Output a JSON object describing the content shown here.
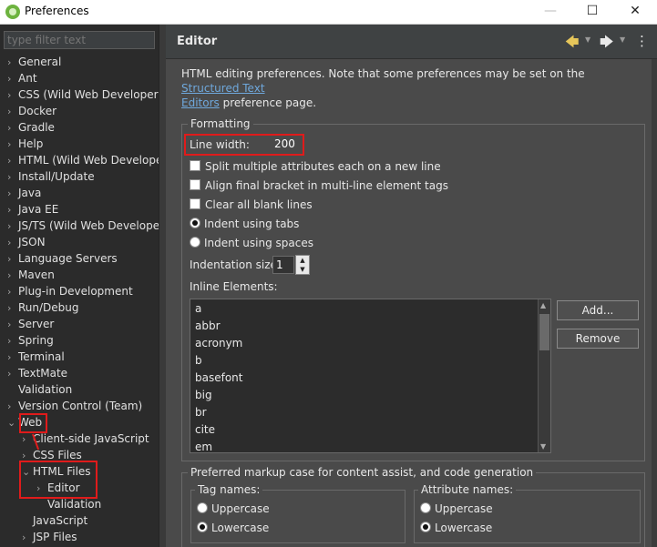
{
  "window": {
    "title": "Preferences",
    "min_label": "—",
    "max_label": "☐",
    "close_label": "✕"
  },
  "filter": {
    "placeholder": "type filter text"
  },
  "tree": [
    {
      "label": "General",
      "arrow": "›"
    },
    {
      "label": "Ant",
      "arrow": "›"
    },
    {
      "label": "CSS (Wild Web Developer)",
      "arrow": "›"
    },
    {
      "label": "Docker",
      "arrow": "›"
    },
    {
      "label": "Gradle",
      "arrow": "›"
    },
    {
      "label": "Help",
      "arrow": "›"
    },
    {
      "label": "HTML (Wild Web Develope",
      "arrow": "›"
    },
    {
      "label": "Install/Update",
      "arrow": "›"
    },
    {
      "label": "Java",
      "arrow": "›"
    },
    {
      "label": "Java EE",
      "arrow": "›"
    },
    {
      "label": "JS/TS (Wild Web Developer",
      "arrow": "›"
    },
    {
      "label": "JSON",
      "arrow": "›"
    },
    {
      "label": "Language Servers",
      "arrow": "›"
    },
    {
      "label": "Maven",
      "arrow": "›"
    },
    {
      "label": "Plug-in Development",
      "arrow": "›"
    },
    {
      "label": "Run/Debug",
      "arrow": "›"
    },
    {
      "label": "Server",
      "arrow": "›"
    },
    {
      "label": "Spring",
      "arrow": "›"
    },
    {
      "label": "Terminal",
      "arrow": "›"
    },
    {
      "label": "TextMate",
      "arrow": "›"
    },
    {
      "label": "Validation",
      "arrow": ""
    },
    {
      "label": "Version Control (Team)",
      "arrow": "›"
    },
    {
      "label": "Web",
      "arrow": "⌄"
    },
    {
      "label": "Client-side JavaScript",
      "arrow": "›"
    },
    {
      "label": "CSS Files",
      "arrow": "›"
    },
    {
      "label": "HTML Files",
      "arrow": "⌄"
    },
    {
      "label": "Editor",
      "arrow": "›"
    },
    {
      "label": "Validation",
      "arrow": ""
    },
    {
      "label": "JavaScript",
      "arrow": ""
    },
    {
      "label": "JSP Files",
      "arrow": "›"
    }
  ],
  "header": {
    "title": "Editor",
    "back_icon": "🡄",
    "forward_icon": "🡆",
    "menu_icon": "⋮"
  },
  "description": {
    "text": "HTML editing preferences.  Note that some preferences may be set on the ",
    "link1": "Structured Text",
    "link2": "Editors",
    "text_after": " preference page."
  },
  "formatting": {
    "legend": "Formatting",
    "line_width_label": "Line width:",
    "line_width_value": "200",
    "split_label": "Split multiple attributes each on a new line",
    "align_label": "Align final bracket in multi-line element tags",
    "clear_label": "Clear all blank lines",
    "indent_tabs_label": "Indent using tabs",
    "indent_spaces_label": "Indent using spaces",
    "indent_size_label": "Indentation size:",
    "indent_size_value": "1",
    "inline_label": "Inline Elements:",
    "inline_items": [
      "a",
      "abbr",
      "acronym",
      "b",
      "basefont",
      "big",
      "br",
      "cite",
      "em"
    ],
    "add_button": "Add...",
    "remove_button": "Remove"
  },
  "markup_case": {
    "legend": "Preferred markup case for content assist, and code generation",
    "tag_legend": "Tag names:",
    "attr_legend": "Attribute names:",
    "uppercase": "Uppercase",
    "lowercase": "Lowercase"
  },
  "colors": {
    "highlight": "#e01b1b",
    "link": "#6fa8dc",
    "spring_icon": "#6db33f"
  }
}
